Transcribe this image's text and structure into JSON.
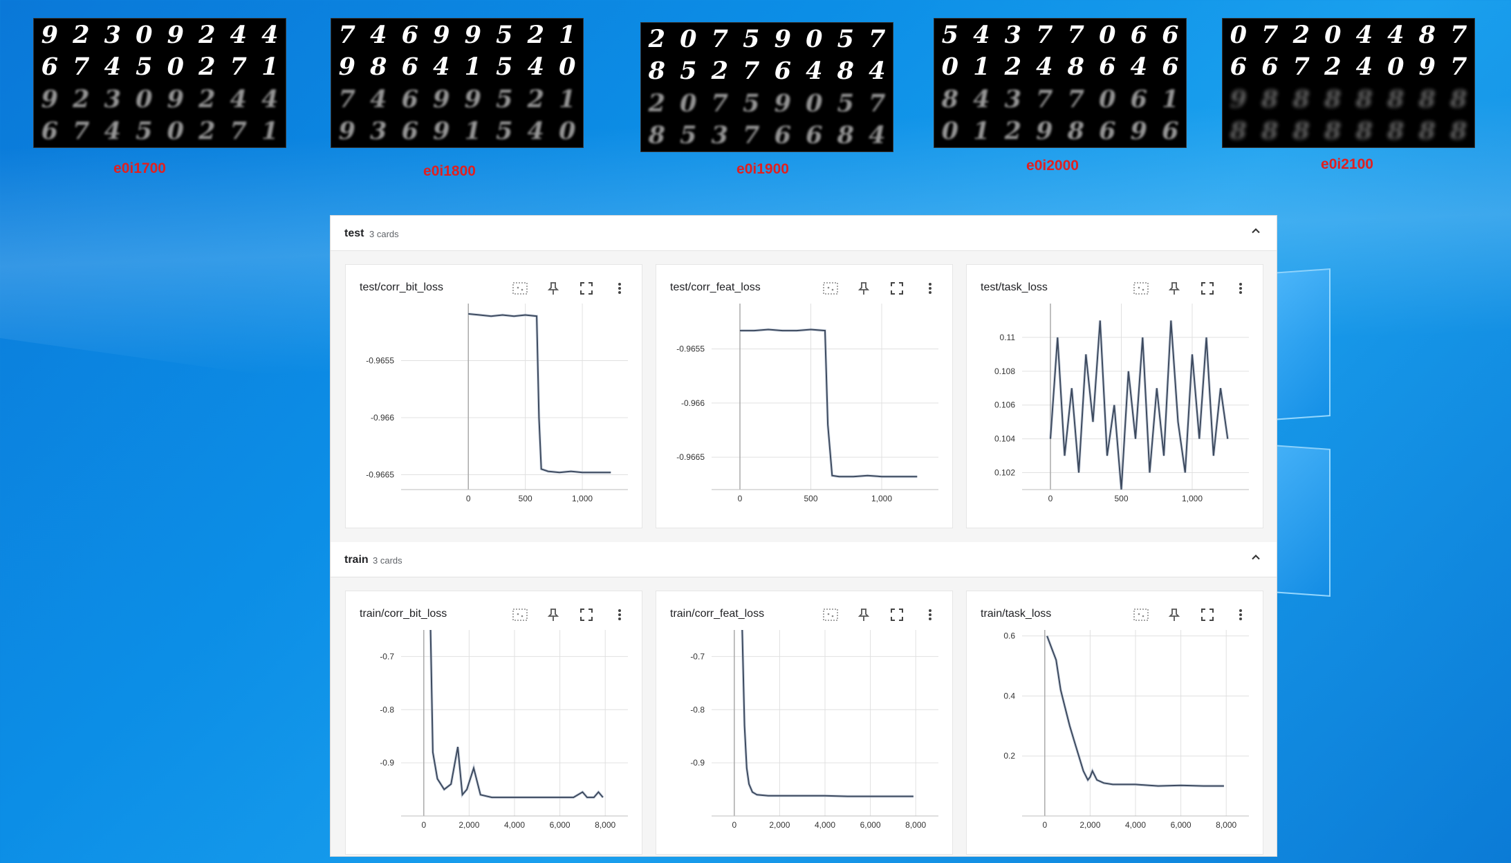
{
  "thumbnails": [
    {
      "label": "e0i1700",
      "rows": [
        "92309244",
        "67450271",
        "92309244",
        "67450271"
      ]
    },
    {
      "label": "e0i1800",
      "rows": [
        "74699521",
        "98641540",
        "74699521",
        "93691540"
      ]
    },
    {
      "label": "e0i1900",
      "rows": [
        "20759057",
        "85276484",
        "20759057",
        "85376684"
      ]
    },
    {
      "label": "e0i2000",
      "rows": [
        "54377066",
        "01248646",
        "84377061",
        "01298696"
      ]
    },
    {
      "label": "e0i2100",
      "rows": [
        "07204487",
        "66724097",
        "98888888",
        "88888888"
      ]
    }
  ],
  "sections": [
    {
      "title": "test",
      "count": "3 cards",
      "toggle_icon": "chevron-up-icon"
    },
    {
      "title": "train",
      "count": "3 cards",
      "toggle_icon": "chevron-up-icon"
    }
  ],
  "cards": {
    "test_corr_bit_loss": {
      "title": "test/corr_bit_loss"
    },
    "test_corr_feat_loss": {
      "title": "test/corr_feat_loss"
    },
    "test_task_loss": {
      "title": "test/task_loss"
    },
    "train_corr_bit_loss": {
      "title": "train/corr_bit_loss"
    },
    "train_corr_feat_loss": {
      "title": "train/corr_feat_loss"
    },
    "train_task_loss": {
      "title": "train/task_loss"
    }
  },
  "card_tools": [
    "select-data-icon",
    "pin-icon",
    "fullscreen-icon",
    "more-vert-icon"
  ],
  "colors": {
    "line": "#3d4a5f",
    "line_raw": "#b8c3d3",
    "accent_label": "#e02020"
  },
  "chart_data": [
    {
      "id": "test_corr_bit_loss",
      "type": "line",
      "x_ticks": [
        0,
        500,
        1000
      ],
      "x_tick_labels": [
        "0",
        "500",
        "1,000"
      ],
      "xlim": [
        -590,
        1400
      ],
      "y_ticks": [
        -0.9655,
        -0.966,
        -0.9665
      ],
      "y_tick_labels": [
        "-0.9655",
        "-0.966",
        "-0.9665"
      ],
      "ylim": [
        -0.96663,
        -0.965
      ],
      "series": [
        {
          "x": [
            0,
            100,
            200,
            300,
            400,
            500,
            600,
            620,
            640,
            700,
            800,
            900,
            1000,
            1100,
            1250
          ],
          "y": [
            -0.96509,
            -0.9651,
            -0.96511,
            -0.9651,
            -0.96511,
            -0.9651,
            -0.96511,
            -0.966,
            -0.96645,
            -0.96647,
            -0.96648,
            -0.96647,
            -0.96648,
            -0.96648,
            -0.96648
          ]
        }
      ]
    },
    {
      "id": "test_corr_feat_loss",
      "type": "line",
      "x_ticks": [
        0,
        500,
        1000
      ],
      "x_tick_labels": [
        "0",
        "500",
        "1,000"
      ],
      "xlim": [
        -200,
        1400
      ],
      "y_ticks": [
        -0.9655,
        -0.966,
        -0.9665
      ],
      "y_tick_labels": [
        "-0.9655",
        "-0.966",
        "-0.9665"
      ],
      "ylim": [
        -0.9668,
        -0.96508
      ],
      "series": [
        {
          "x": [
            0,
            100,
            200,
            300,
            400,
            500,
            600,
            620,
            650,
            700,
            800,
            900,
            1000,
            1100,
            1250
          ],
          "y": [
            -0.96533,
            -0.96533,
            -0.96532,
            -0.96533,
            -0.96533,
            -0.96532,
            -0.96533,
            -0.9662,
            -0.96667,
            -0.96668,
            -0.96668,
            -0.96667,
            -0.96668,
            -0.96668,
            -0.96668
          ]
        }
      ]
    },
    {
      "id": "test_task_loss",
      "type": "line",
      "x_ticks": [
        0,
        500,
        1000
      ],
      "x_tick_labels": [
        "0",
        "500",
        "1,000"
      ],
      "xlim": [
        -200,
        1400
      ],
      "y_ticks": [
        0.102,
        0.104,
        0.106,
        0.108,
        0.11
      ],
      "y_tick_labels": [
        "0.102",
        "0.104",
        "0.106",
        "0.108",
        "0.11"
      ],
      "ylim": [
        0.101,
        0.112
      ],
      "series": [
        {
          "x": [
            0,
            50,
            100,
            150,
            200,
            250,
            300,
            350,
            400,
            450,
            500,
            550,
            600,
            650,
            700,
            750,
            800,
            850,
            900,
            950,
            1000,
            1050,
            1100,
            1150,
            1200,
            1250
          ],
          "y": [
            0.104,
            0.11,
            0.103,
            0.107,
            0.102,
            0.109,
            0.105,
            0.111,
            0.103,
            0.106,
            0.101,
            0.108,
            0.104,
            0.11,
            0.102,
            0.107,
            0.103,
            0.111,
            0.105,
            0.102,
            0.109,
            0.104,
            0.11,
            0.103,
            0.107,
            0.104
          ]
        }
      ]
    },
    {
      "id": "train_corr_bit_loss",
      "type": "line",
      "x_ticks": [
        0,
        2000,
        4000,
        6000,
        8000
      ],
      "x_tick_labels": [
        "0",
        "2,000",
        "4,000",
        "6,000",
        "8,000"
      ],
      "xlim": [
        -1000,
        9000
      ],
      "y_ticks": [
        -0.7,
        -0.8,
        -0.9
      ],
      "y_tick_labels": [
        "-0.7",
        "-0.8",
        "-0.9"
      ],
      "ylim": [
        -1.0,
        -0.65
      ],
      "series": [
        {
          "x": [
            300,
            400,
            600,
            900,
            1200,
            1500,
            1700,
            1900,
            2200,
            2500,
            3000,
            4000,
            5000,
            6000,
            6600,
            7000,
            7200,
            7500,
            7700,
            7900
          ],
          "y": [
            -0.65,
            -0.88,
            -0.93,
            -0.95,
            -0.94,
            -0.87,
            -0.96,
            -0.95,
            -0.91,
            -0.96,
            -0.965,
            -0.965,
            -0.965,
            -0.965,
            -0.965,
            -0.955,
            -0.965,
            -0.965,
            -0.955,
            -0.965
          ]
        }
      ]
    },
    {
      "id": "train_corr_feat_loss",
      "type": "line",
      "x_ticks": [
        0,
        2000,
        4000,
        6000,
        8000
      ],
      "x_tick_labels": [
        "0",
        "2,000",
        "4,000",
        "6,000",
        "8,000"
      ],
      "xlim": [
        -1000,
        9000
      ],
      "y_ticks": [
        -0.7,
        -0.8,
        -0.9
      ],
      "y_tick_labels": [
        "-0.7",
        "-0.8",
        "-0.9"
      ],
      "ylim": [
        -1.0,
        -0.65
      ],
      "series": [
        {
          "x": [
            350,
            450,
            550,
            650,
            800,
            1000,
            1500,
            2000,
            3000,
            4000,
            5000,
            6000,
            7000,
            7900
          ],
          "y": [
            -0.65,
            -0.83,
            -0.91,
            -0.94,
            -0.955,
            -0.96,
            -0.962,
            -0.962,
            -0.962,
            -0.962,
            -0.963,
            -0.963,
            -0.963,
            -0.963
          ]
        }
      ]
    },
    {
      "id": "train_task_loss",
      "type": "line",
      "x_ticks": [
        0,
        2000,
        4000,
        6000,
        8000
      ],
      "x_tick_labels": [
        "0",
        "2,000",
        "4,000",
        "6,000",
        "8,000"
      ],
      "xlim": [
        -1000,
        9000
      ],
      "y_ticks": [
        0.2,
        0.4,
        0.6
      ],
      "y_tick_labels": [
        "0.2",
        "0.4",
        "0.6"
      ],
      "ylim": [
        0.0,
        0.62
      ],
      "series": [
        {
          "x": [
            100,
            300,
            500,
            700,
            900,
            1100,
            1300,
            1500,
            1700,
            1900,
            2000,
            2100,
            2300,
            2600,
            3000,
            4000,
            5000,
            6000,
            7000,
            7900
          ],
          "y": [
            0.6,
            0.56,
            0.52,
            0.42,
            0.36,
            0.3,
            0.25,
            0.2,
            0.15,
            0.12,
            0.13,
            0.15,
            0.12,
            0.11,
            0.105,
            0.105,
            0.1,
            0.102,
            0.1,
            0.1
          ]
        }
      ]
    }
  ]
}
